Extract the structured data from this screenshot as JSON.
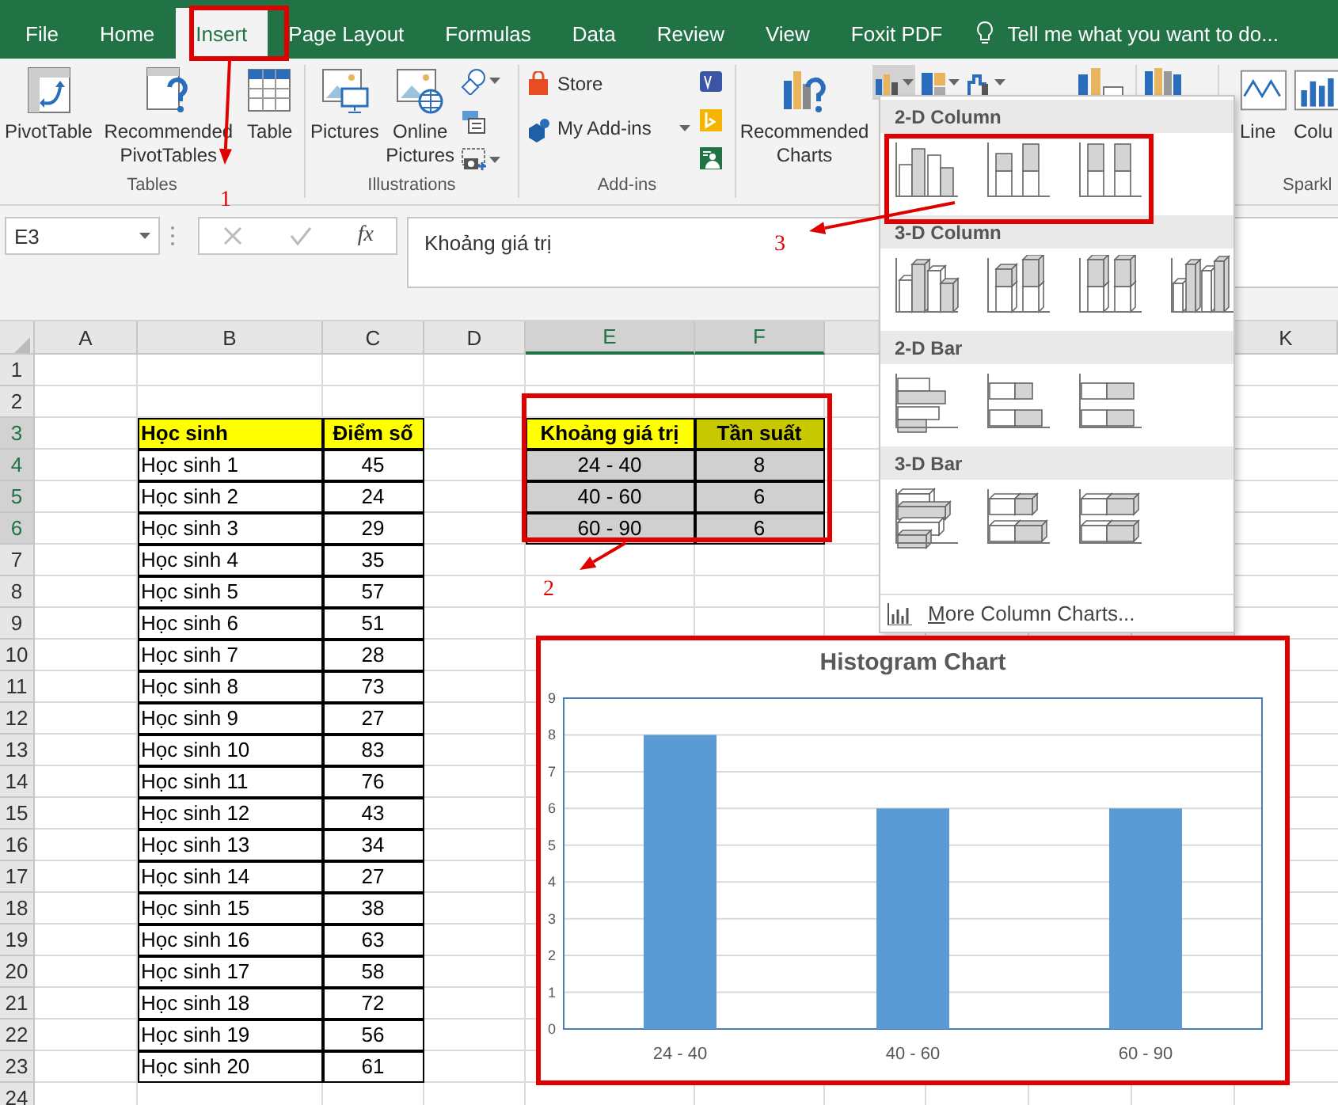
{
  "tabs": [
    {
      "label": "File",
      "selected": false
    },
    {
      "label": "Home",
      "selected": false
    },
    {
      "label": "Insert",
      "selected": true
    },
    {
      "label": "Page Layout",
      "selected": false
    },
    {
      "label": "Formulas",
      "selected": false
    },
    {
      "label": "Data",
      "selected": false
    },
    {
      "label": "Review",
      "selected": false
    },
    {
      "label": "View",
      "selected": false
    },
    {
      "label": "Foxit PDF",
      "selected": false
    }
  ],
  "tell_me": {
    "placeholder": "Tell me what you want to do..."
  },
  "ribbon": [
    {
      "label": "Tables",
      "columns": [
        [
          {
            "kind": "large",
            "label": "PivotTable"
          }
        ],
        [
          {
            "kind": "large",
            "label": "Recommended PivotTables"
          }
        ],
        [
          {
            "kind": "large",
            "label": "Table"
          }
        ]
      ]
    },
    {
      "label": "Illustrations",
      "columns": [
        [
          {
            "kind": "large",
            "label": "Pictures"
          }
        ],
        [
          {
            "kind": "large",
            "label": "Online Pictures"
          }
        ],
        [
          {
            "kind": "icon",
            "dropdown": true
          },
          {
            "kind": "icon",
            "dropdown": false
          },
          {
            "kind": "icon",
            "dropdown": true
          }
        ]
      ]
    },
    {
      "label": "Add-ins",
      "columns": [
        [
          {
            "kind": "small",
            "label": "Store",
            "dropdown": false
          },
          {
            "kind": "small",
            "label": "My Add-ins",
            "dropdown": true
          }
        ],
        [
          {
            "kind": "icon",
            "dropdown": false
          },
          {
            "kind": "icon",
            "dropdown": false
          },
          {
            "kind": "icon",
            "dropdown": false
          }
        ]
      ]
    },
    {
      "columns": [
        [
          {
            "kind": "large",
            "label": "Recommended Charts"
          }
        ],
        [
          {
            "kind": "icon",
            "dropdown": true,
            "pressed": true
          }
        ],
        [
          {
            "kind": "icon",
            "dropdown": true,
            "pressed": false
          }
        ],
        [
          {
            "kind": "icon",
            "dropdown": true,
            "pressed": false
          }
        ],
        [
          {
            "kind": "tall_icon"
          }
        ]
      ]
    },
    {
      "columns": [
        [
          {
            "kind": "tall_icon"
          }
        ]
      ]
    },
    {
      "label": "Sparkl",
      "columns": [
        [
          {
            "kind": "large",
            "label": "Line"
          }
        ],
        [
          {
            "kind": "large",
            "label": "Colu"
          }
        ]
      ]
    }
  ],
  "formula_bar": {
    "name_box": "E3",
    "function_label": "fx",
    "formula": "Khoảng giá trị"
  },
  "columns": [
    {
      "label": "A",
      "selected": false
    },
    {
      "label": "B",
      "selected": false
    },
    {
      "label": "C",
      "selected": false
    },
    {
      "label": "D",
      "selected": false
    },
    {
      "label": "E",
      "selected": true
    },
    {
      "label": "F",
      "selected": true
    },
    {
      "selected": false
    },
    {
      "label": "K",
      "selected": false
    }
  ],
  "rows": [
    {
      "number": "1",
      "selected": false
    },
    {
      "number": "2",
      "selected": false
    },
    {
      "number": "3",
      "selected": true
    },
    {
      "number": "4",
      "selected": true
    },
    {
      "number": "5",
      "selected": true
    },
    {
      "number": "6",
      "selected": true
    },
    {
      "number": "7",
      "selected": false
    },
    {
      "number": "8",
      "selected": false
    },
    {
      "number": "9",
      "selected": false
    },
    {
      "number": "10",
      "selected": false
    },
    {
      "number": "11",
      "selected": false
    },
    {
      "number": "12",
      "selected": false
    },
    {
      "number": "13",
      "selected": false
    },
    {
      "number": "14",
      "selected": false
    },
    {
      "number": "15",
      "selected": false
    },
    {
      "number": "16",
      "selected": false
    },
    {
      "number": "17",
      "selected": false
    },
    {
      "number": "18",
      "selected": false
    },
    {
      "number": "19",
      "selected": false
    },
    {
      "number": "20",
      "selected": false
    },
    {
      "number": "21",
      "selected": false
    },
    {
      "number": "22",
      "selected": false
    },
    {
      "number": "23",
      "selected": false
    },
    {
      "number": "24",
      "selected": false
    }
  ],
  "student_table": {
    "header": [
      "Học sinh",
      "Điểm số"
    ],
    "rows": [
      [
        "Học sinh 1",
        "45"
      ],
      [
        "Học sinh 2",
        "24"
      ],
      [
        "Học sinh 3",
        "29"
      ],
      [
        "Học sinh 4",
        "35"
      ],
      [
        "Học sinh 5",
        "57"
      ],
      [
        "Học sinh 6",
        "51"
      ],
      [
        "Học sinh 7",
        "28"
      ],
      [
        "Học sinh 8",
        "73"
      ],
      [
        "Học sinh 9",
        "27"
      ],
      [
        "Học sinh 10",
        "83"
      ],
      [
        "Học sinh 11",
        "76"
      ],
      [
        "Học sinh 12",
        "43"
      ],
      [
        "Học sinh 13",
        "34"
      ],
      [
        "Học sinh 14",
        "27"
      ],
      [
        "Học sinh 15",
        "38"
      ],
      [
        "Học sinh 16",
        "63"
      ],
      [
        "Học sinh 17",
        "58"
      ],
      [
        "Học sinh 18",
        "72"
      ],
      [
        "Học sinh 19",
        "56"
      ],
      [
        "Học sinh 20",
        "61"
      ]
    ]
  },
  "frequency_table": {
    "selected": true,
    "header": [
      "Khoảng giá trị",
      "Tần suất"
    ],
    "rows": [
      [
        "24 - 40",
        "8"
      ],
      [
        "40 - 60",
        "6"
      ],
      [
        "60 - 90",
        "6"
      ]
    ]
  },
  "chart": {
    "chart_data": {
      "type": "bar",
      "title": "Histogram Chart",
      "categories": [
        "24 - 40",
        "40 - 60",
        "60 - 90"
      ],
      "series": [
        {
          "color": "#5b9bd5",
          "values": [
            8,
            6,
            6
          ]
        }
      ],
      "grid": true,
      "ylim": [
        0,
        9
      ],
      "yticks": [
        0,
        1,
        2,
        3,
        4,
        5,
        6,
        7,
        8,
        9
      ]
    }
  },
  "chart_menu": {
    "sections": [
      {
        "title": "2-D Column",
        "kind": "column2d",
        "items": [
          {
            "kind": "clustered"
          },
          {
            "kind": "stacked"
          },
          {
            "kind": "stacked100"
          }
        ]
      },
      {
        "title": "3-D Column",
        "kind": "column3d",
        "items": [
          {
            "kind": "clustered"
          },
          {
            "kind": "stacked"
          },
          {
            "kind": "stacked100"
          },
          {
            "kind": "standard"
          }
        ]
      },
      {
        "title": "2-D Bar",
        "kind": "bar2d",
        "items": [
          {
            "kind": "clustered"
          },
          {
            "kind": "stacked"
          },
          {
            "kind": "stacked100"
          }
        ]
      },
      {
        "title": "3-D Bar",
        "kind": "bar3d",
        "items": [
          {
            "kind": "clustered"
          },
          {
            "kind": "stacked"
          },
          {
            "kind": "stacked100"
          }
        ]
      }
    ],
    "footer": "More Column Charts..."
  },
  "callouts": [
    {
      "kind": "numbered",
      "number": "1"
    },
    {
      "kind": "numbered",
      "number": "2"
    },
    {
      "kind": "numbered",
      "number": "3"
    },
    {
      "kind": "box"
    }
  ]
}
